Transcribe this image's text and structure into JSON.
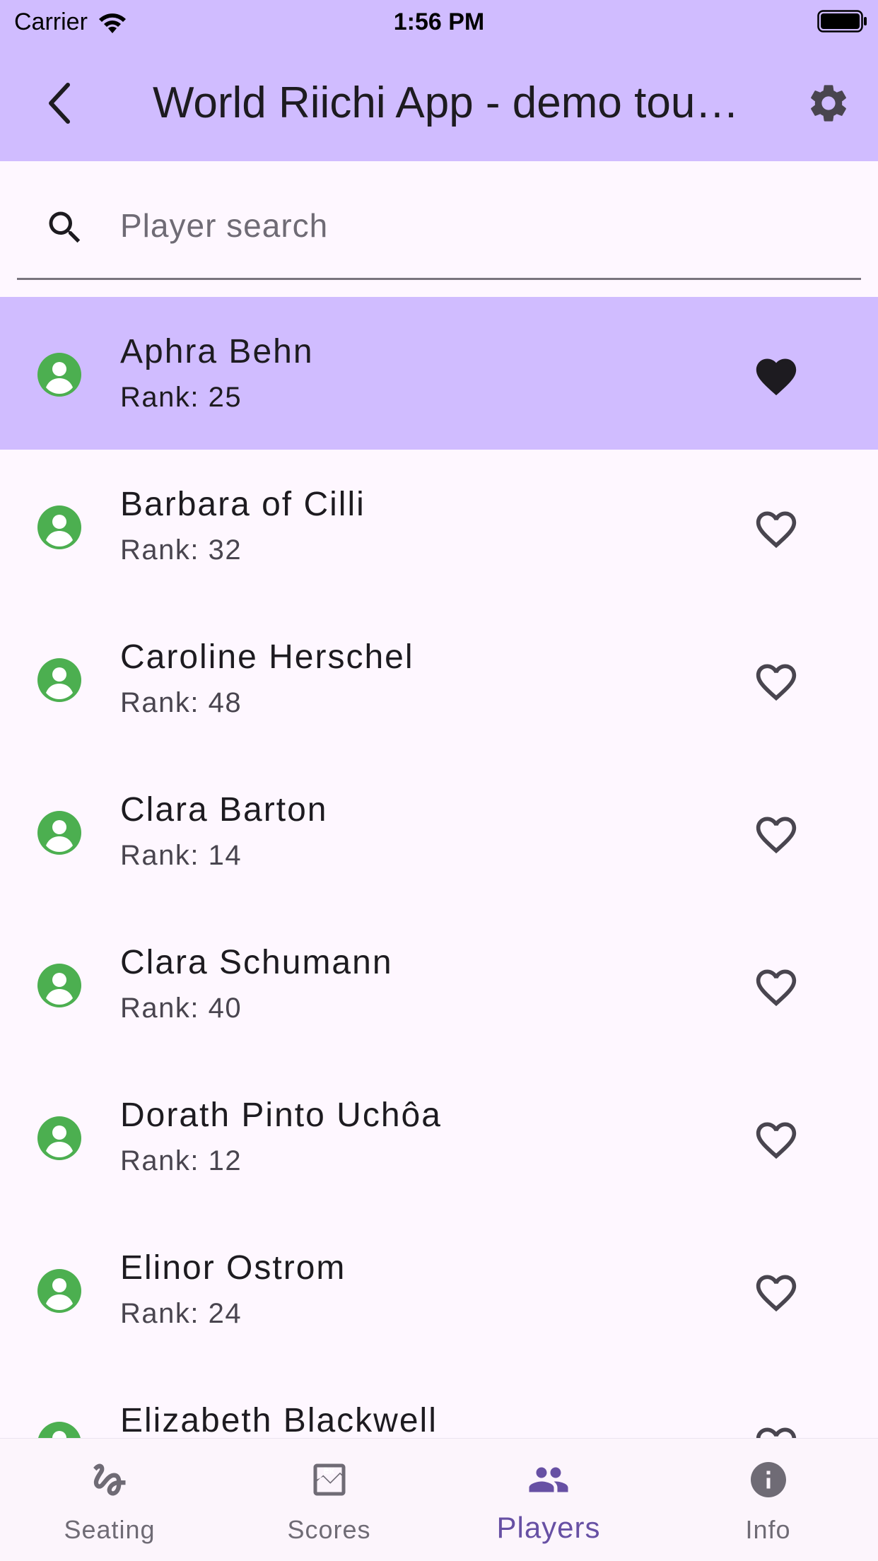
{
  "status_bar": {
    "carrier": "Carrier",
    "time": "1:56 PM"
  },
  "app_bar": {
    "title": "World Riichi App - demo tour…"
  },
  "search": {
    "placeholder": "Player search",
    "value": ""
  },
  "players": [
    {
      "name": "Aphra Behn",
      "rank": "Rank: 25",
      "favorite": true,
      "selected": true
    },
    {
      "name": "Barbara of Cilli",
      "rank": "Rank: 32",
      "favorite": false,
      "selected": false
    },
    {
      "name": "Caroline Herschel",
      "rank": "Rank: 48",
      "favorite": false,
      "selected": false
    },
    {
      "name": "Clara Barton",
      "rank": "Rank: 14",
      "favorite": false,
      "selected": false
    },
    {
      "name": "Clara Schumann",
      "rank": "Rank: 40",
      "favorite": false,
      "selected": false
    },
    {
      "name": "Dorath Pinto Uchôa",
      "rank": "Rank: 12",
      "favorite": false,
      "selected": false
    },
    {
      "name": "Elinor Ostrom",
      "rank": "Rank: 24",
      "favorite": false,
      "selected": false
    },
    {
      "name": "Elizabeth Blackwell",
      "rank": "",
      "favorite": false,
      "selected": false
    }
  ],
  "nav": [
    {
      "label": "Seating",
      "icon": "seat-icon",
      "active": false
    },
    {
      "label": "Scores",
      "icon": "scoreboard-icon",
      "active": false
    },
    {
      "label": "Players",
      "icon": "people-icon",
      "active": true
    },
    {
      "label": "Info",
      "icon": "info-icon",
      "active": false
    }
  ],
  "colors": {
    "app_bar": "#d0bcff",
    "selected_row": "#d0bcff",
    "avatar": "#4caf50",
    "active_nav": "#6750a4",
    "inactive_nav": "#6f6b75"
  }
}
